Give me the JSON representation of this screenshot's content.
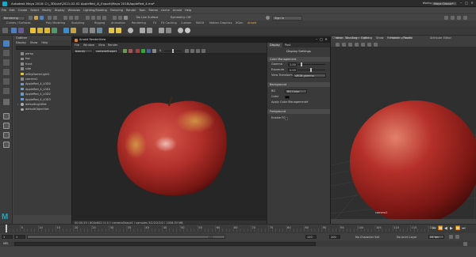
{
  "app": {
    "title": "Autodesk Maya 2018: C:\\_3D\\carl\\2021-02-02 AppleRed_4\\_Export\\Maya 2018\\AppleRed_4.ma*",
    "workspace_label": "Workspace :",
    "workspace_value": "Maya Classic*"
  },
  "menubar": [
    "File",
    "Edit",
    "Create",
    "Select",
    "Modify",
    "Display",
    "Windows",
    "Lighting/Shading",
    "Texturing",
    "Render",
    "Toon",
    "Stereo",
    "Cache",
    "Arnold",
    "Help"
  ],
  "statusline": {
    "mode": "Rendering",
    "live": "No Live Surface",
    "symmetry": "Symmetry: Off",
    "signin": "Sign In"
  },
  "shelf_tabs": [
    "Curves / Surfaces",
    "Poly Modeling",
    "Sculpting",
    "Rigging",
    "Animation",
    "Rendering",
    "FX",
    "FX Caching",
    "Custom",
    "MASH",
    "Motion Graphics",
    "XGen",
    "Arnold"
  ],
  "shelf_active": "Arnold",
  "outliner": {
    "title": "Outliner",
    "menu": [
      "Display",
      "Show",
      "Help"
    ],
    "items": [
      {
        "label": "persp",
        "icon": "camera-icon"
      },
      {
        "label": "top",
        "icon": "camera-icon"
      },
      {
        "label": "front",
        "icon": "camera-icon"
      },
      {
        "label": "side",
        "icon": "camera-icon"
      },
      {
        "label": "aiSkyDomeLight1",
        "icon": "light-icon"
      },
      {
        "label": "camera1",
        "icon": "camera-icon"
      },
      {
        "label": "AppleRed_4_LOD0",
        "icon": "mesh-icon"
      },
      {
        "label": "AppleRed_4_LOD1",
        "icon": "mesh-icon"
      },
      {
        "label": "AppleRed_4_LOD2",
        "icon": "mesh-icon"
      },
      {
        "label": "AppleRed_4_LOD3",
        "icon": "mesh-icon"
      },
      {
        "label": "defaultLightSet",
        "icon": "set-icon"
      },
      {
        "label": "defaultObjectSet",
        "icon": "set-icon"
      }
    ]
  },
  "viewport": {
    "menu": [
      "View",
      "Shading",
      "Lighting",
      "Show",
      "Renderer",
      "Panels"
    ],
    "camera_label": "camera1"
  },
  "renderview": {
    "title": "Arnold RenderView",
    "menu": [
      "File",
      "Window",
      "View",
      "Render"
    ],
    "aov": "beauty",
    "camera": "cameraShape1",
    "exposure": "0",
    "status": "00:00:29 | 800x600 (1:1) | cameraShape1 | samples 3/2/2/2/2/2 | 1056.53 MB"
  },
  "display_settings": {
    "tabs": [
      "Display",
      "Post"
    ],
    "title": "Display Settings",
    "color_mgmt_header": "Color Management",
    "gamma_label": "Gamma",
    "gamma_value": "1.0000",
    "exposure_label": "Exposure",
    "exposure_value": "0.0000",
    "view_transform_label": "View Transform",
    "view_transform_value": "sRGB gamma",
    "background_header": "Background",
    "bg_label": "BG",
    "bg_value": "BG Color",
    "color_label": "Color",
    "apply_cm_label": "Apply Color Management",
    "apply_cm_checked": "✔",
    "foreground_header": "Foreground",
    "enable_fg_label": "Enable FG"
  },
  "channel_box": {
    "tabs": [
      "Channel Box / Layer Editor",
      "Modeling Toolkit",
      "Attribute Editor"
    ],
    "menu": [
      "Channels",
      "Edit",
      "Object",
      "Show"
    ],
    "layers": [
      "Display",
      "Anim"
    ],
    "layer_menu": [
      "Layers",
      "Options",
      "Help"
    ]
  },
  "timeline": {
    "ticks": [
      "5",
      "10",
      "15",
      "20",
      "25",
      "30",
      "35",
      "40",
      "45",
      "50",
      "55",
      "60",
      "65",
      "70",
      "75",
      "80",
      "85",
      "90",
      "95",
      "100",
      "105",
      "110",
      "115",
      "120"
    ],
    "current_frame": "1"
  },
  "range": {
    "start": "1",
    "inner_start": "1",
    "inner_end": "120",
    "end": "120",
    "end2": "200",
    "fps": "24 fps",
    "character_set": "No Character Set",
    "anim_layer": "No Anim Layer"
  },
  "cmdline": {
    "lang": "MEL"
  },
  "colors": {
    "accent": "#f0b15a",
    "maya_logo": "#16a9c7"
  }
}
